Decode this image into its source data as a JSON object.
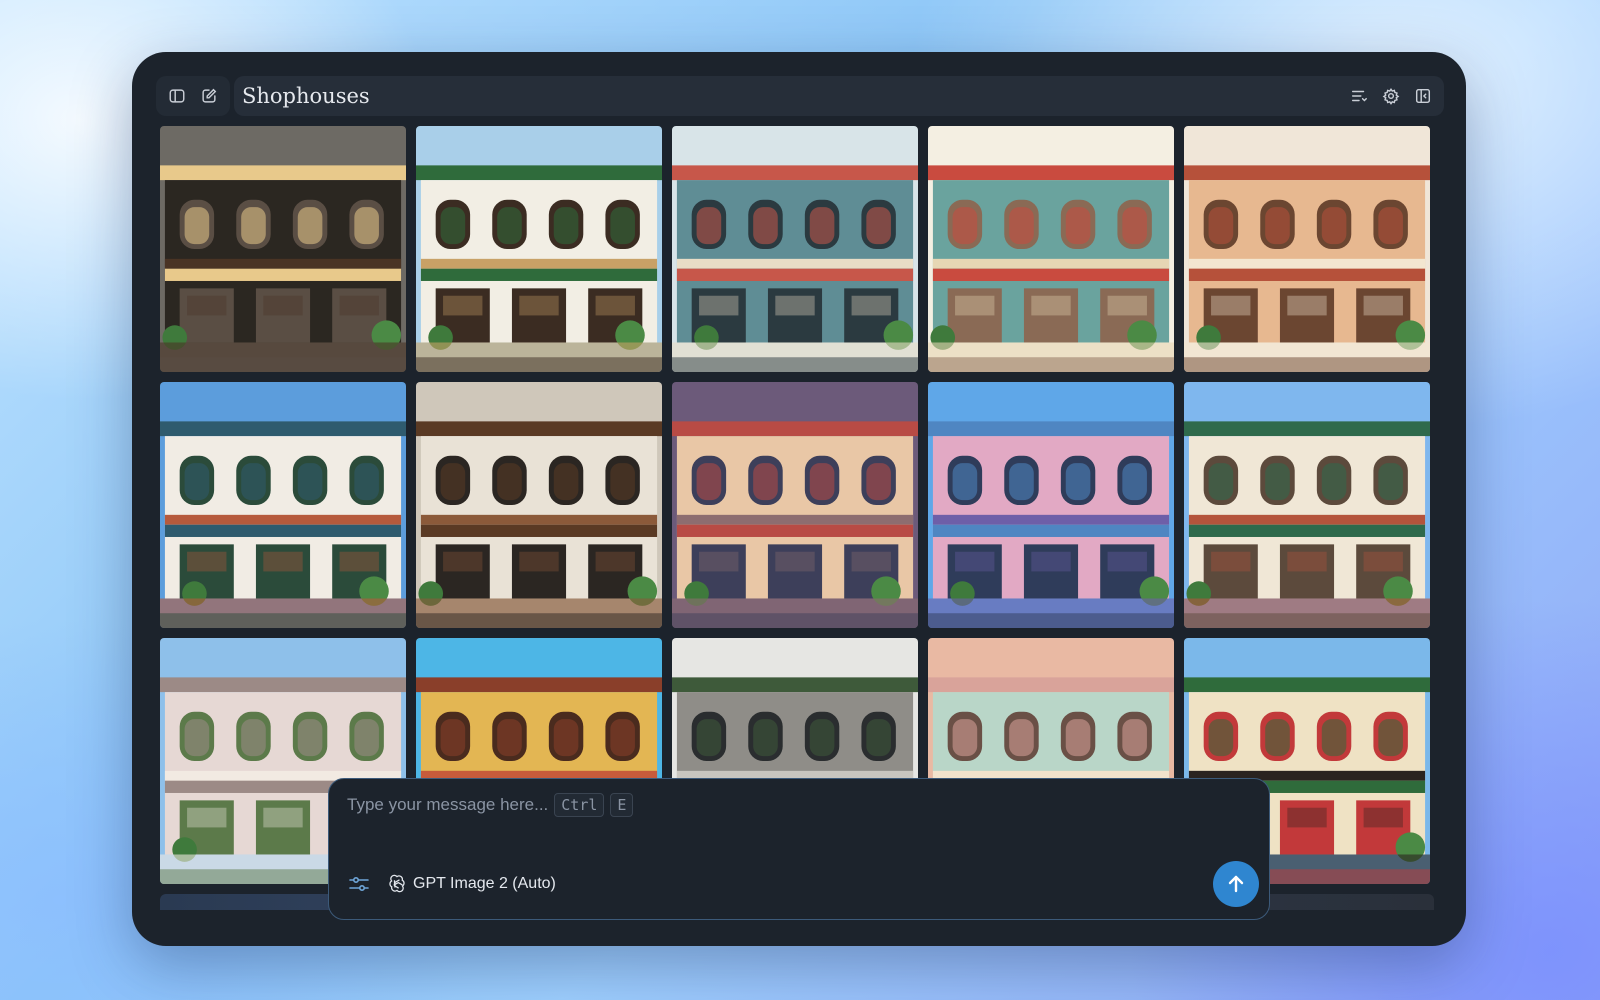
{
  "window": {
    "title": "Shophouses"
  },
  "toolbar": {
    "left_icons": [
      "sidebar-toggle-icon",
      "new-chat-icon"
    ],
    "right_icons": [
      "list-icon",
      "gear-icon",
      "panel-icon"
    ]
  },
  "gallery": {
    "tiles": [
      {
        "name": "tile-1-1",
        "palette": [
          "#2b2721",
          "#e8c98b",
          "#4a3424",
          "#5a4e44"
        ],
        "sky": "#6d6a64"
      },
      {
        "name": "tile-1-2",
        "palette": [
          "#f2eee4",
          "#2f6b3b",
          "#c8a166",
          "#3b2c22"
        ],
        "sky": "#a9cfe9"
      },
      {
        "name": "tile-1-3",
        "palette": [
          "#5f8d95",
          "#c7574a",
          "#e8ddc6",
          "#2b3a40"
        ],
        "sky": "#d8e4e8"
      },
      {
        "name": "tile-1-4",
        "palette": [
          "#6aa39e",
          "#c94b3f",
          "#e6d6b4",
          "#8a6a55"
        ],
        "sky": "#f4efe2"
      },
      {
        "name": "tile-1-5",
        "palette": [
          "#e7b890",
          "#b6513a",
          "#f3e6d0",
          "#6b4631"
        ],
        "sky": "#f0e6d8"
      },
      {
        "name": "tile-2-1",
        "palette": [
          "#f1ece4",
          "#2f5b6e",
          "#b65a3c",
          "#2b4b3a"
        ],
        "sky": "#5c9ddc"
      },
      {
        "name": "tile-2-2",
        "palette": [
          "#e9e2d6",
          "#5a3a24",
          "#8b5a3a",
          "#2b2622"
        ],
        "sky": "#cfc7ba"
      },
      {
        "name": "tile-2-3",
        "palette": [
          "#e9c7a6",
          "#b84b45",
          "#8d6d70",
          "#3d3f5a"
        ],
        "sky": "#6c5a7a"
      },
      {
        "name": "tile-2-4",
        "palette": [
          "#e2a9c4",
          "#4f86c2",
          "#6e5fa8",
          "#2f3c5a"
        ],
        "sky": "#5fa7e8"
      },
      {
        "name": "tile-2-5",
        "palette": [
          "#f0e7d6",
          "#2f6a4c",
          "#b4543c",
          "#5c4a3c"
        ],
        "sky": "#7fb7ee"
      },
      {
        "name": "tile-3-1",
        "palette": [
          "#e6d8d4",
          "#9c8a86",
          "#f2eae2",
          "#5c7a4a"
        ],
        "sky": "#8ec0ea"
      },
      {
        "name": "tile-3-2",
        "palette": [
          "#e3b653",
          "#8a3f2a",
          "#c75b3b",
          "#4a2b1e"
        ],
        "sky": "#4db6e6"
      },
      {
        "name": "tile-3-3",
        "palette": [
          "#8f8d88",
          "#3e5a3a",
          "#c9c6bf",
          "#2a2d2f"
        ],
        "sky": "#e6e6e3"
      },
      {
        "name": "tile-3-4",
        "palette": [
          "#b9d6c8",
          "#d9a39a",
          "#f2e3cc",
          "#6a5046"
        ],
        "sky": "#e9b9a3"
      },
      {
        "name": "tile-3-5",
        "palette": [
          "#efe2c4",
          "#2f6b3b",
          "#2a2320",
          "#c2393a"
        ],
        "sky": "#7bb8ea"
      }
    ]
  },
  "composer": {
    "placeholder": "Type your message here...",
    "shortcut_key1": "Ctrl",
    "shortcut_key2": "E",
    "model_label": "GPT Image 2 (Auto)"
  }
}
